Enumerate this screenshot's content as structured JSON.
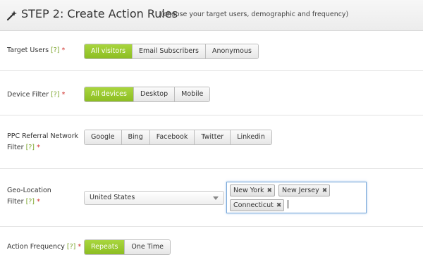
{
  "header": {
    "title": "STEP 2: Create Action Rules",
    "subtitle": "(choose your target users, demographic and frequency)"
  },
  "rows": {
    "target_users": {
      "label": "Target Users",
      "help": "[?]",
      "required": "*",
      "options": [
        "All visitors",
        "Email Subscribers",
        "Anonymous"
      ],
      "selected": "All visitors"
    },
    "device_filter": {
      "label": "Device Filter",
      "help": "[?]",
      "required": "*",
      "options": [
        "All devices",
        "Desktop",
        "Mobile"
      ],
      "selected": "All devices"
    },
    "ppc_filter": {
      "label_line1": "PPC Referral Network",
      "label_line2": "Filter",
      "help": "[?]",
      "required": "*",
      "options": [
        "Google",
        "Bing",
        "Facebook",
        "Twitter",
        "Linkedin"
      ]
    },
    "geo_filter": {
      "label_line1": "Geo-Location",
      "label_line2": "Filter",
      "help": "[?]",
      "required": "*",
      "country": "United States",
      "states": [
        "New York",
        "New Jersey",
        "Connecticut"
      ],
      "remove_glyph": "✖"
    },
    "action_frequency": {
      "label": "Action Frequency",
      "help": "[?]",
      "required": "*",
      "options": [
        "Repeats",
        "One Time"
      ],
      "selected": "Repeats"
    }
  },
  "colors": {
    "active_green": "#97c72a",
    "help_green": "#7aa32a",
    "required_red": "#d0312d",
    "focus_blue": "#7aa9d9"
  },
  "icons": {
    "header": "magic-wand-icon",
    "select": "chevron-down-icon",
    "tag_remove": "close-icon"
  }
}
